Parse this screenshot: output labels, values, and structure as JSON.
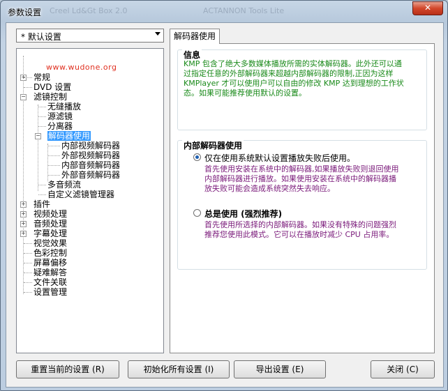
{
  "window": {
    "title": "参数设置",
    "close_label": "✕",
    "ghost_texts": [
      "Creel Ld&Gt Box 2.0",
      "ACTANNON Tools Lite"
    ]
  },
  "settings_combo": {
    "value": "* 默认设置"
  },
  "watermark": "www.wudone.org",
  "tree": {
    "items": [
      {
        "label": "常规"
      },
      {
        "label": "DVD 设置"
      },
      {
        "label": "滤镜控制"
      },
      {
        "label": "无缝播放"
      },
      {
        "label": "源滤镜"
      },
      {
        "label": "分离器"
      },
      {
        "label": "解码器使用"
      },
      {
        "label": "内部视频解码器"
      },
      {
        "label": "外部视频解码器"
      },
      {
        "label": "内部音频解码器"
      },
      {
        "label": "外部音频解码器"
      },
      {
        "label": "多音频流"
      },
      {
        "label": "自定义滤镜管理器"
      },
      {
        "label": "插件"
      },
      {
        "label": "视频处理"
      },
      {
        "label": "音频处理"
      },
      {
        "label": "字幕处理"
      },
      {
        "label": "视觉效果"
      },
      {
        "label": "色彩控制"
      },
      {
        "label": "屏幕偏移"
      },
      {
        "label": "疑难解答"
      },
      {
        "label": "文件关联"
      },
      {
        "label": "设置管理"
      }
    ]
  },
  "tab": {
    "label": "解码器使用"
  },
  "info": {
    "title": "信息",
    "lines": [
      "KMP 包含了绝大多数媒体播放所需的实体解码器。此外还可以通",
      "过指定任意的外部解码器来超越内部解码器的限制,正因为这样",
      "KMPlayer 才可以使用户可以自由的修改 KMP 达到理想的工作状",
      "态。如果可能推荐使用默认的设置。"
    ]
  },
  "internal_decoder": {
    "title": "内部解码器使用",
    "option1": {
      "label": "仅在使用系统默认设置播放失败后使用。",
      "desc": [
        "首先使用安装在系统中的解码器,如果播放失败则退回使用",
        "内部解码器进行播放。如果使用安装在系统中的解码器播",
        "放失败可能会造成系统突然失去响应。"
      ]
    },
    "option2": {
      "label": "总是使用 (强烈推荐)",
      "desc": [
        "首先使用所选择的内部解码器。如果没有特殊的问题强烈",
        "推荐您使用此模式。它可以在播放时减少 CPU 占用率。"
      ]
    }
  },
  "buttons": {
    "reset_current": "重置当前的设置 (R)",
    "init_all": "初始化所有设置 (I)",
    "export": "导出设置 (E)",
    "close": "关闭 (C)"
  },
  "colors": {
    "info_text": "#1a8a1a",
    "desc_text": "#7a1a7a",
    "watermark": "#e03020",
    "selection": "#3399ff"
  }
}
